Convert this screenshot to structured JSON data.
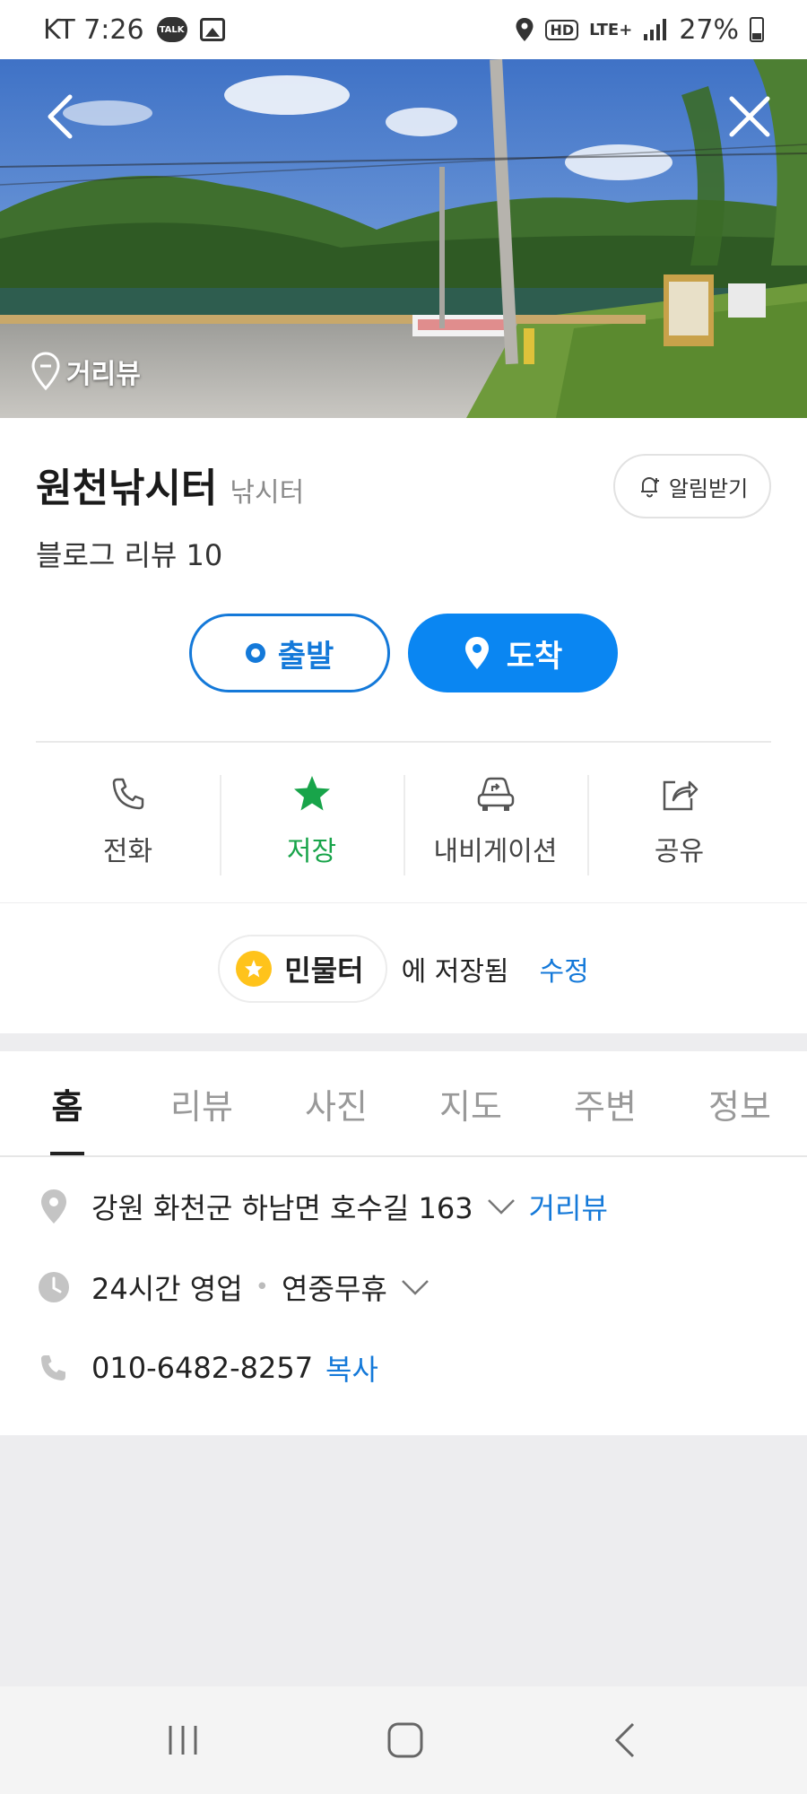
{
  "status": {
    "carrier_time": "KT 7:26",
    "talk_label": "TALK",
    "hd": "HD",
    "lte": "LTE+",
    "battery": "27%"
  },
  "hero": {
    "roadview_label": "거리뷰"
  },
  "place": {
    "name": "원천낚시터",
    "category": "낚시터",
    "review": "블로그 리뷰 10",
    "alarm_label": "알림받기"
  },
  "route": {
    "depart": "출발",
    "arrive": "도착"
  },
  "actions": {
    "call": "전화",
    "save": "저장",
    "navigation": "내비게이션",
    "share": "공유"
  },
  "saved": {
    "folder": "민물터",
    "text": "에 저장됨",
    "edit": "수정"
  },
  "tabs": [
    "홈",
    "리뷰",
    "사진",
    "지도",
    "주변",
    "정보"
  ],
  "details": {
    "address": "강원 화천군 하남면 호수길 163",
    "address_link": "거리뷰",
    "hours": "24시간 영업",
    "holiday": "연중무휴",
    "phone": "010-6482-8257",
    "phone_link": "복사"
  },
  "colors": {
    "accent": "#0a86f2",
    "saved_green": "#18a44a",
    "star_yellow": "#ffc31b"
  }
}
